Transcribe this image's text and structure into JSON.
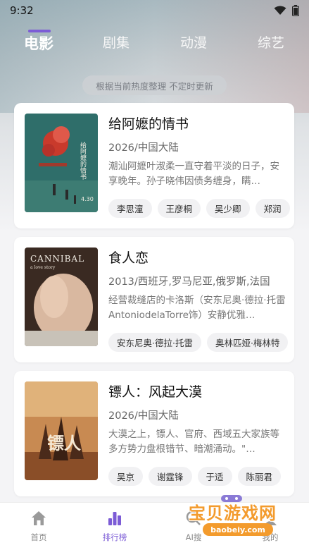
{
  "status": {
    "time": "9:32"
  },
  "tabs": [
    {
      "label": "电影",
      "active": true
    },
    {
      "label": "剧集",
      "active": false
    },
    {
      "label": "动漫",
      "active": false
    },
    {
      "label": "综艺",
      "active": false
    }
  ],
  "notice": "根据当前热度整理 不定时更新",
  "cards": [
    {
      "title": "给阿嬷的情书",
      "meta": "2026/中国大陆",
      "desc": "潮汕阿嬷叶淑柔一直守着平淡的日子，安享晚年。孙子晓伟因债务缠身，瞒…",
      "cast": [
        "李思潼",
        "王彦桐",
        "吴少卿",
        "郑润"
      ],
      "poster_text": "给阿嬷的情书",
      "poster_date": "4.30"
    },
    {
      "title": "食人恋",
      "meta": "2013/西班牙,罗马尼亚,俄罗斯,法国",
      "desc": "经营裁缝店的卡洛斯（安东尼奥·德拉·托雷AntoniodelaTorre饰）安静优雅…",
      "cast": [
        "安东尼奥·德拉·托雷",
        "奥林匹娅·梅林特"
      ],
      "poster_text": "CANNIBAL",
      "poster_sub": "a love story"
    },
    {
      "title": "镖人：风起大漠",
      "meta": "2026/中国大陆",
      "desc": "大漠之上，镖人、官府、西域五大家族等多方势力盘根错节、暗潮涌动。\"…",
      "cast": [
        "吴京",
        "谢霆锋",
        "于适",
        "陈丽君"
      ],
      "poster_text": "镖人"
    }
  ],
  "bottom_nav": [
    {
      "label": "首页",
      "icon": "home-icon",
      "active": false
    },
    {
      "label": "排行榜",
      "icon": "ranking-icon",
      "active": true
    },
    {
      "label": "AI搜",
      "icon": "ai-search-icon",
      "active": false
    },
    {
      "label": "我的",
      "icon": "profile-icon",
      "active": false
    }
  ],
  "watermark": {
    "text": "宝贝游戏网",
    "url": "baobeiy.com"
  },
  "colors": {
    "accent": "#7c5cd6",
    "watermark": "#f39b2d"
  }
}
